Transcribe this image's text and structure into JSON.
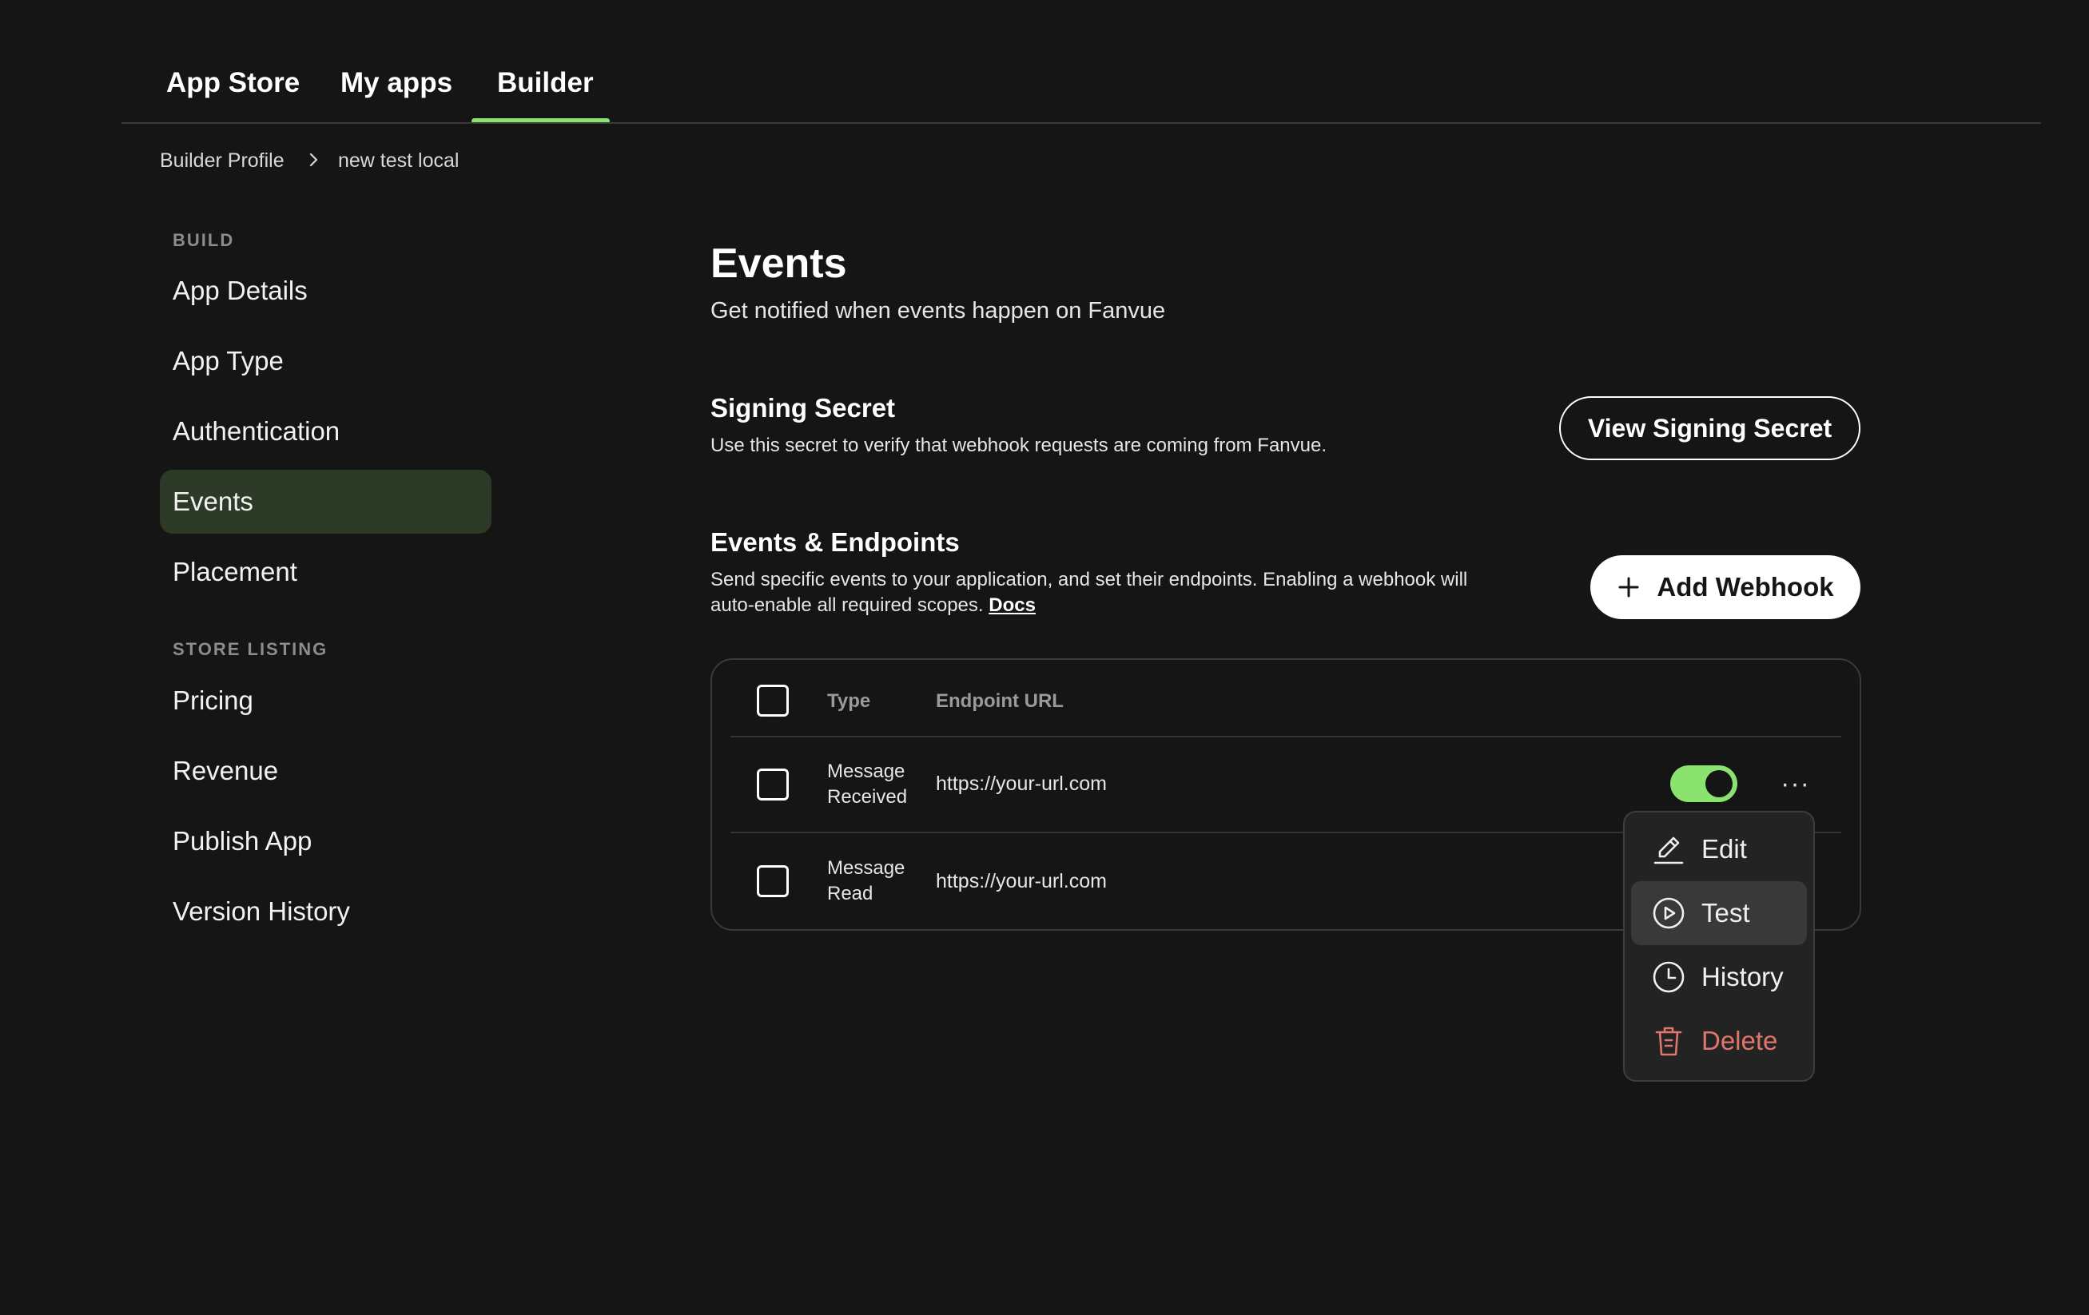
{
  "top_tabs": [
    {
      "label": "App Store"
    },
    {
      "label": "My apps"
    },
    {
      "label": "Builder",
      "active": true
    }
  ],
  "breadcrumb": {
    "parent": "Builder Profile",
    "current": "new test local"
  },
  "sidebar": {
    "build_label": "BUILD",
    "build_items": [
      {
        "label": "App Details"
      },
      {
        "label": "App Type"
      },
      {
        "label": "Authentication"
      },
      {
        "label": "Events",
        "active": true
      },
      {
        "label": "Placement"
      }
    ],
    "store_label": "STORE LISTING",
    "store_items": [
      {
        "label": "Pricing"
      },
      {
        "label": "Revenue"
      },
      {
        "label": "Publish App"
      },
      {
        "label": "Version History"
      }
    ]
  },
  "main": {
    "title": "Events",
    "subtitle": "Get notified when events happen on Fanvue",
    "signing": {
      "title": "Signing Secret",
      "description": "Use this secret to verify that webhook requests are coming from Fanvue.",
      "button": "View Signing Secret"
    },
    "endpoints": {
      "title": "Events & Endpoints",
      "description_line1": "Send specific events to your application, and set their endpoints. Enabling a webhook will",
      "description_line2": "auto-enable all required scopes.",
      "docs_link": "Docs",
      "add_button": "Add Webhook"
    },
    "table": {
      "columns": [
        "Type",
        "Endpoint URL"
      ],
      "rows": [
        {
          "type_line1": "Message",
          "type_line2": "Received",
          "url": "https://your-url.com",
          "enabled": true
        },
        {
          "type_line1": "Message",
          "type_line2": "Read",
          "url": "https://your-url.com"
        }
      ]
    },
    "row_menu": {
      "items": [
        {
          "label": "Edit",
          "icon": "pencil-icon"
        },
        {
          "label": "Test",
          "icon": "play-circle-icon",
          "hovered": true
        },
        {
          "label": "History",
          "icon": "clock-icon"
        },
        {
          "label": "Delete",
          "icon": "trash-icon",
          "danger": true
        }
      ]
    }
  },
  "colors": {
    "background": "#151515",
    "accent": "#8be36f",
    "active_sidebar": "#2d3a27",
    "danger": "#e0766b"
  }
}
